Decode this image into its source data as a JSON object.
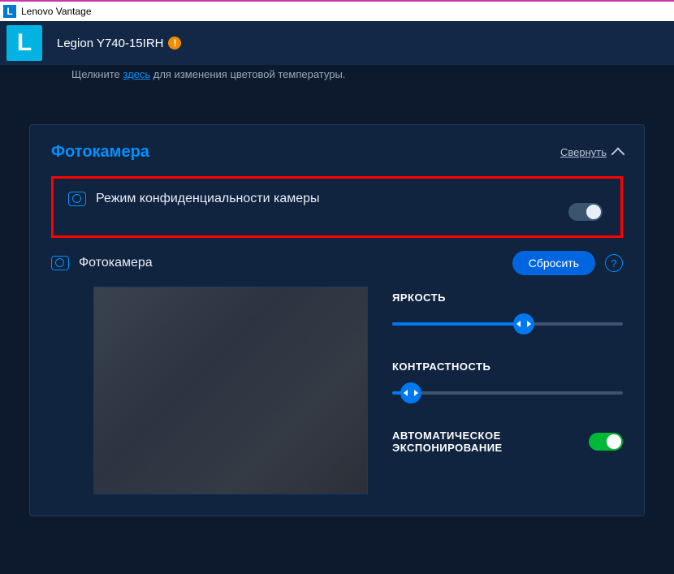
{
  "window": {
    "title": "Lenovo Vantage"
  },
  "header": {
    "model": "Legion Y740-15IRH"
  },
  "hint": {
    "prefix": "Щелкните ",
    "link": "здесь",
    "suffix": " для изменения цветовой температуры."
  },
  "camera_card": {
    "title": "Фотокамера",
    "collapse_label": "Свернуть",
    "privacy": {
      "label": "Режим конфиденциальности камеры",
      "enabled": false
    },
    "settings": {
      "label": "Фотокамера",
      "reset_label": "Сбросить",
      "brightness": {
        "label": "ЯРКОСТЬ",
        "value": 57
      },
      "contrast": {
        "label": "КОНТРАСТНОСТЬ",
        "value": 8
      },
      "auto_exposure": {
        "label": "АВТОМАТИЧЕСКОЕ ЭКСПОНИРОВАНИЕ",
        "enabled": true
      }
    }
  }
}
